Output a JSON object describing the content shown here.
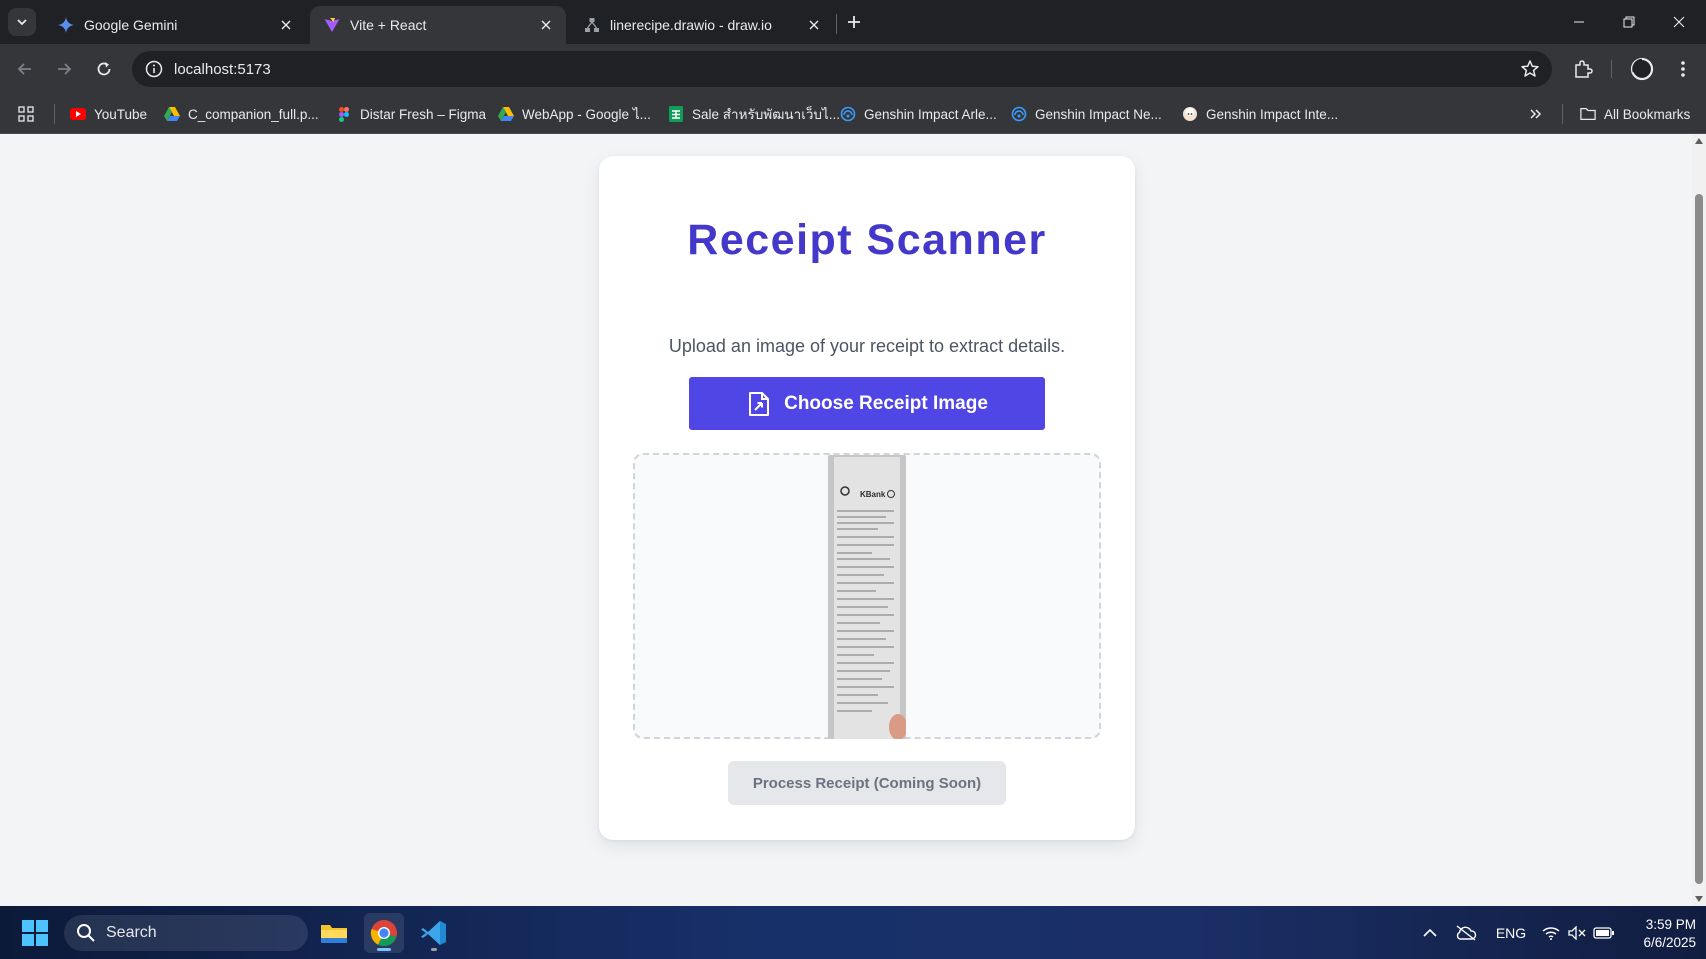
{
  "browser": {
    "tabs": [
      {
        "title": "Google Gemini",
        "icon": "gemini-icon",
        "active": false
      },
      {
        "title": "Vite + React",
        "icon": "vite-icon",
        "active": true
      },
      {
        "title": "linerecipe.drawio - draw.io",
        "icon": "drawio-icon",
        "active": false
      }
    ],
    "url": "localhost:5173",
    "bookmarks": [
      {
        "label": "YouTube",
        "icon": "youtube-icon"
      },
      {
        "label": "C_companion_full.p...",
        "icon": "google-drive-icon"
      },
      {
        "label": "Distar Fresh – Figma",
        "icon": "figma-icon"
      },
      {
        "label": "WebApp - Google ไ...",
        "icon": "google-drive-icon"
      },
      {
        "label": "Sale สำหรับพัฒนาเว็บไ...",
        "icon": "google-sheets-icon"
      },
      {
        "label": "Genshin Impact Arle...",
        "icon": "hoyolab-icon"
      },
      {
        "label": "Genshin Impact Ne...",
        "icon": "hoyolab-icon"
      },
      {
        "label": "Genshin Impact Inte...",
        "icon": "paimon-icon"
      }
    ],
    "all_bookmarks_label": "All Bookmarks"
  },
  "app": {
    "title": "Receipt Scanner",
    "subtitle": "Upload an image of your receipt to extract details.",
    "choose_button": "Choose Receipt Image",
    "process_button": "Process Receipt (Coming Soon)",
    "receipt_preview": {
      "brand": "KBank",
      "alt": "receipt-image-preview"
    },
    "colors": {
      "title": "#4338ca",
      "primary_button": "#4f46e5",
      "disabled_button": "#e5e7eb"
    }
  },
  "taskbar": {
    "search_placeholder": "Search",
    "language": "ENG",
    "time": "3:59 PM",
    "date": "6/6/2025"
  }
}
